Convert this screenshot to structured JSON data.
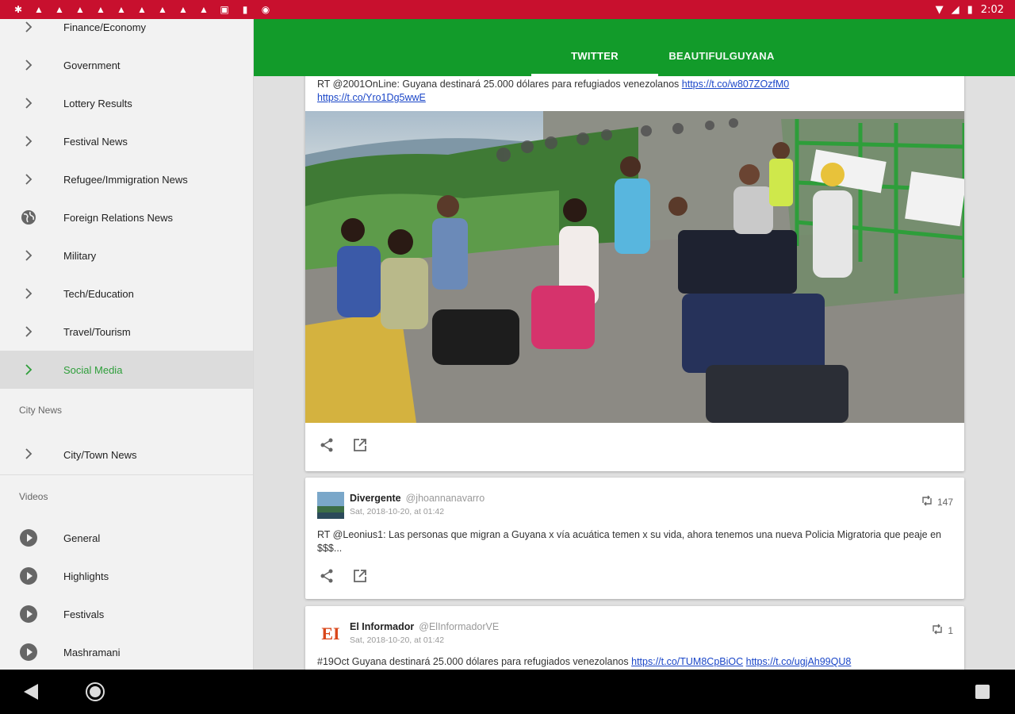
{
  "status": {
    "time": "2:02"
  },
  "drawer": {
    "items": [
      {
        "label": "Finance/Economy",
        "icon": "chevron-right-icon"
      },
      {
        "label": "Government",
        "icon": "chevron-right-icon"
      },
      {
        "label": "Lottery Results",
        "icon": "chevron-right-icon"
      },
      {
        "label": "Festival News",
        "icon": "chevron-right-icon"
      },
      {
        "label": "Refugee/Immigration News",
        "icon": "chevron-right-icon"
      },
      {
        "label": "Foreign Relations News",
        "icon": "globe-icon"
      },
      {
        "label": "Military",
        "icon": "chevron-right-icon"
      },
      {
        "label": "Tech/Education",
        "icon": "chevron-right-icon"
      },
      {
        "label": "Travel/Tourism",
        "icon": "chevron-right-icon"
      },
      {
        "label": "Social Media",
        "icon": "chevron-right-icon",
        "active": true
      }
    ],
    "city_header": "City News",
    "city_items": [
      {
        "label": "City/Town News"
      }
    ],
    "videos_header": "Videos",
    "video_items": [
      {
        "label": "General"
      },
      {
        "label": "Highlights"
      },
      {
        "label": "Festivals"
      },
      {
        "label": "Mashramani"
      }
    ]
  },
  "tabs": [
    {
      "label": "TWITTER",
      "selected": true
    },
    {
      "label": "BEAUTIFULGUYANA",
      "selected": false
    }
  ],
  "tweets": [
    {
      "text": "RT @2001OnLine: Guyana destinará 25.000 dólares para refugiados venezolanos",
      "link1": "https://t.co/w807ZOzfM0",
      "link2": "https://t.co/Yro1Dg5wwE"
    },
    {
      "user": "Divergente",
      "handle": "@jhoannanavarro",
      "date": "Sat, 2018-10-20, at 01:42",
      "retweets": "147",
      "text": "RT @Leonius1: Las personas que migran a Guyana x vía acuática temen x su vida, ahora tenemos una nueva Policia Migratoria que peaje en $$$..."
    },
    {
      "user": "El Informador",
      "handle": "@ElInformadorVE",
      "date": "Sat, 2018-10-20, at 01:42",
      "retweets": "1",
      "avatar_text": "EI",
      "text": "#19Oct Guyana destinará 25.000 dólares para refugiados venezolanos",
      "link1": "https://t.co/TUM8CpBiOC",
      "link2": "https://t.co/ugjAh99QU8"
    }
  ],
  "colors": {
    "status_bar": "#c8102e",
    "app_bar": "#129b2a",
    "accent": "#2e9e3a",
    "link": "#1a46c8"
  }
}
